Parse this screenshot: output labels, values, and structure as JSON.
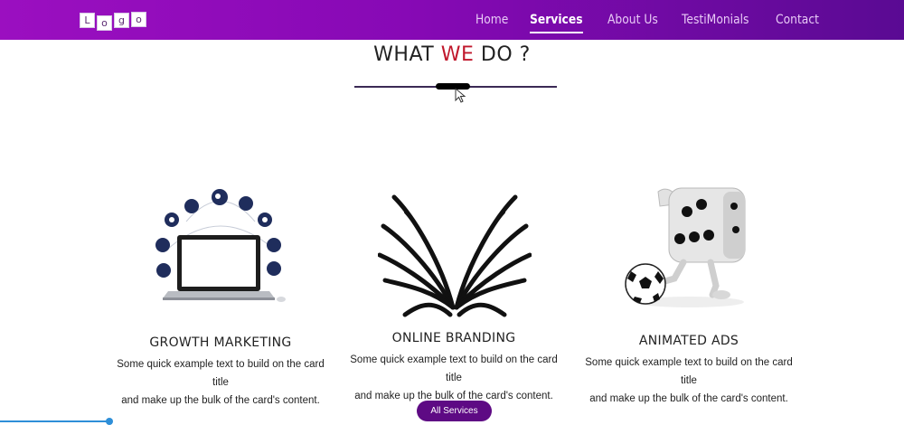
{
  "logo": {
    "letters": [
      "L",
      "o",
      "g",
      "o"
    ]
  },
  "nav": {
    "items": [
      {
        "label": "Home"
      },
      {
        "label": "Services",
        "active": true
      },
      {
        "label": "About Us"
      },
      {
        "label": "TestiMonials"
      },
      {
        "label": "Contact"
      }
    ]
  },
  "section": {
    "title_part1": "WHAT ",
    "title_accent": "WE",
    "title_part2": " DO ?"
  },
  "cards": [
    {
      "title": "GROWTH MARKETING",
      "text_line1": "Some quick example text to build on the card title",
      "text_line2": "and make up the bulk of the card's content.",
      "icon": "laptop-network-icon"
    },
    {
      "title": "ONLINE BRANDING",
      "text_line1": "Some quick example text to build on the card title",
      "text_line2": "and make up the bulk of the card's content.",
      "icon": "butterfly-logo-icon"
    },
    {
      "title": "ANIMATED ADS",
      "text_line1": "Some quick example text to build on the card title",
      "text_line2": "and make up the bulk of the card's content.",
      "icon": "dice-character-icon"
    }
  ],
  "button": {
    "label": "All Services"
  },
  "colors": {
    "nav_start": "#9b0fc0",
    "nav_end": "#5a0a93",
    "accent_red": "#c0182c",
    "button": "#5e0a84"
  }
}
